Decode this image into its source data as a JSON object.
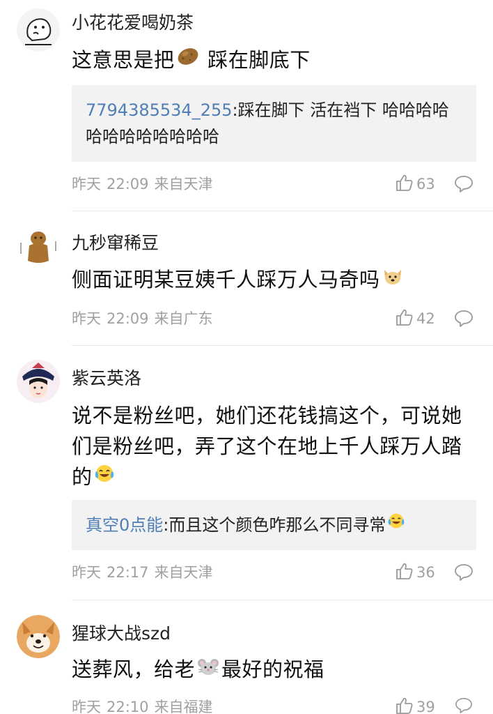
{
  "comments": [
    {
      "username": "小花花爱喝奶茶",
      "text_before": "这意思是把",
      "emoji": "potato",
      "text_after": " 踩在脚底下",
      "reply": {
        "user": "7794385534_255",
        "text": ":踩在脚下 活在裆下 哈哈哈哈哈哈哈哈哈哈哈哈"
      },
      "date": "昨天",
      "time": "22:09",
      "location": "来自天津",
      "likes": "63"
    },
    {
      "username": "九秒窜稀豆",
      "text_before": "侧面证明某豆姨千人踩万人马奇吗",
      "emoji": "doge",
      "text_after": "",
      "date": "昨天",
      "time": "22:09",
      "location": "来自广东",
      "likes": "42"
    },
    {
      "username": "紫云英洛",
      "text_before": "说不是粉丝吧，她们还花钱搞这个，可说她们是粉丝吧，弄了这个在地上千人踩万人踏的",
      "emoji": "laugh-cry",
      "text_after": "",
      "reply": {
        "user": "真空0点能",
        "text": ":而且这个颜色咋那么不同寻常"
      },
      "date": "昨天",
      "time": "22:17",
      "location": "来自天津",
      "likes": "36"
    },
    {
      "username": "猩球大战szd",
      "text_before": "送葬风，给老",
      "emoji": "mouse",
      "text_after": "最好的祝福",
      "date": "昨天",
      "time": "22:10",
      "location": "来自福建",
      "likes": "39"
    }
  ]
}
